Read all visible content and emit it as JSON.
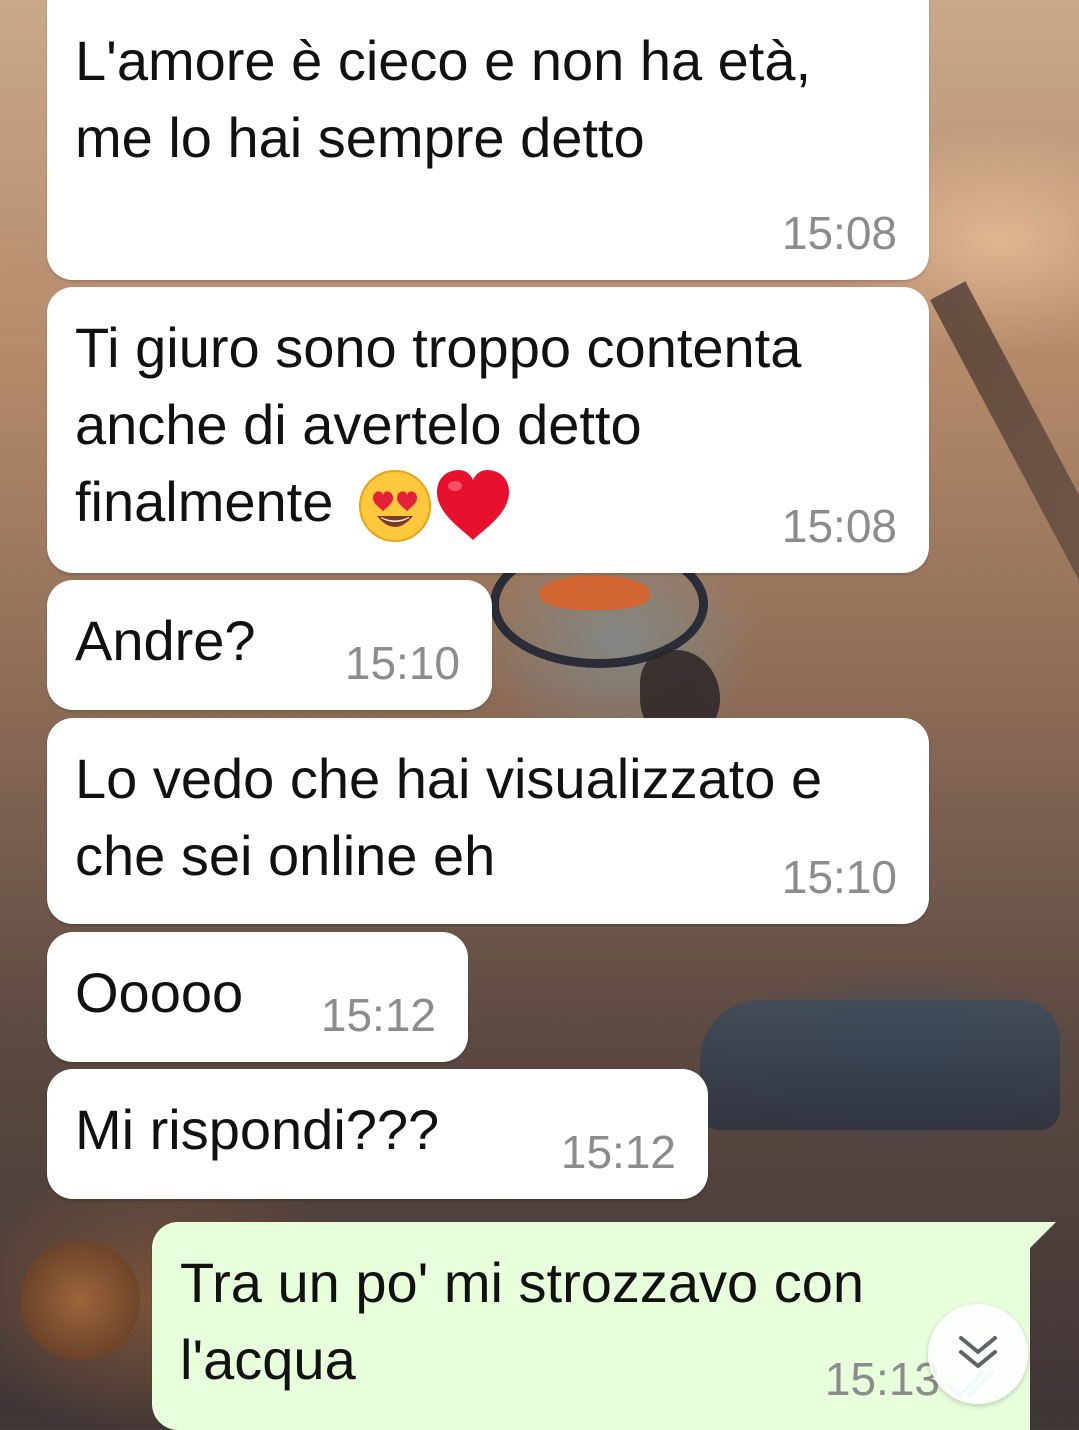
{
  "messages": [
    {
      "direction": "incoming",
      "text": "L'amore è cieco e non ha età, me lo hai sempre detto",
      "time": "15:08"
    },
    {
      "direction": "incoming",
      "text": "Ti giuro sono troppo contenta anche di avertelo detto finalmente",
      "emojis": "😍❤️",
      "time": "15:08"
    },
    {
      "direction": "incoming",
      "text": "Andre?",
      "time": "15:10"
    },
    {
      "direction": "incoming",
      "text": "Lo vedo che hai visualizzato e che sei online eh",
      "time": "15:10"
    },
    {
      "direction": "incoming",
      "text": "Ooooo",
      "time": "15:12"
    },
    {
      "direction": "incoming",
      "text": "Mi rispondi???",
      "time": "15:12"
    },
    {
      "direction": "outgoing",
      "text": "Tra un po' mi strozzavo con l'acqua",
      "time": "15:13",
      "status": "read"
    }
  ],
  "icons": {
    "scroll_down": "double-chevron-down-icon",
    "read_receipt": "double-check-icon",
    "emoji_1": "heart-eyes-emoji",
    "emoji_2": "red-heart-emoji"
  },
  "colors": {
    "incoming_bubble": "#ffffff",
    "outgoing_bubble": "#e7ffdb",
    "timestamp": "#8c8c8c",
    "read_ticks": "#8ecdf2"
  }
}
